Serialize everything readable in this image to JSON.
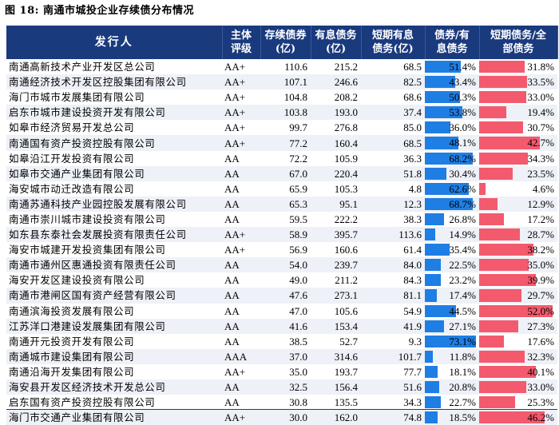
{
  "title": "图 18:  南通市城投企业存续债分布情况",
  "table": {
    "headers": {
      "issuer": "发行人",
      "rating": [
        "主体",
        "评级"
      ],
      "outstanding": [
        "存续债券",
        "(亿)"
      ],
      "interest_debt": [
        "有息债务",
        "(亿)"
      ],
      "short_term_debt": [
        "短期有息",
        "债务(亿)"
      ],
      "bond_ratio": [
        "债券/有",
        "息债务"
      ],
      "short_ratio": [
        "短期债务/全",
        "部债务"
      ]
    },
    "colors": {
      "header_bg": "#1a3a7e",
      "bar_blue": "#1f7ee3",
      "bar_red": "#f35a6d",
      "stripe": "#eef1f7"
    },
    "rows": [
      {
        "name": "南通高新技术产业开发区总公司",
        "rating": "AA+",
        "outstanding": "110.6",
        "interest_debt": "215.2",
        "short_term": "68.5",
        "bond_ratio": "51.4%",
        "bond_ratio_value": 0.514,
        "short_ratio": "31.8%",
        "short_ratio_value": 0.318
      },
      {
        "name": "南通经济技术开发区控股集团有限公司",
        "rating": "AA+",
        "outstanding": "107.1",
        "interest_debt": "246.6",
        "short_term": "82.5",
        "bond_ratio": "43.4%",
        "bond_ratio_value": 0.434,
        "short_ratio": "33.5%",
        "short_ratio_value": 0.335
      },
      {
        "name": "海门市城市发展集团有限公司",
        "rating": "AA+",
        "outstanding": "104.8",
        "interest_debt": "208.2",
        "short_term": "68.6",
        "bond_ratio": "50.3%",
        "bond_ratio_value": 0.503,
        "short_ratio": "33.0%",
        "short_ratio_value": 0.33
      },
      {
        "name": "启东市城市建设投资开发有限公司",
        "rating": "AA+",
        "outstanding": "103.8",
        "interest_debt": "193.0",
        "short_term": "37.4",
        "bond_ratio": "53.8%",
        "bond_ratio_value": 0.538,
        "short_ratio": "19.4%",
        "short_ratio_value": 0.194
      },
      {
        "name": "如皋市经济贸易开发总公司",
        "rating": "AA+",
        "outstanding": "99.7",
        "interest_debt": "276.8",
        "short_term": "85.0",
        "bond_ratio": "36.0%",
        "bond_ratio_value": 0.36,
        "short_ratio": "30.7%",
        "short_ratio_value": 0.307
      },
      {
        "name": "南通国有资产投资控股有限公司",
        "rating": "AA+",
        "outstanding": "77.2",
        "interest_debt": "160.4",
        "short_term": "68.5",
        "bond_ratio": "48.1%",
        "bond_ratio_value": 0.481,
        "short_ratio": "42.7%",
        "short_ratio_value": 0.427
      },
      {
        "name": "如皋沿江开发投资有限公司",
        "rating": "AA",
        "outstanding": "72.2",
        "interest_debt": "105.9",
        "short_term": "36.3",
        "bond_ratio": "68.2%",
        "bond_ratio_value": 0.682,
        "short_ratio": "34.3%",
        "short_ratio_value": 0.343
      },
      {
        "name": "如皋市交通产业集团有限公司",
        "rating": "AA",
        "outstanding": "67.0",
        "interest_debt": "220.4",
        "short_term": "51.8",
        "bond_ratio": "30.4%",
        "bond_ratio_value": 0.304,
        "short_ratio": "23.5%",
        "short_ratio_value": 0.235
      },
      {
        "name": "海安城市动迁改造有限公司",
        "rating": "AA",
        "outstanding": "65.9",
        "interest_debt": "105.3",
        "short_term": "4.8",
        "bond_ratio": "62.6%",
        "bond_ratio_value": 0.626,
        "short_ratio": "4.6%",
        "short_ratio_value": 0.046
      },
      {
        "name": "南通苏通科技产业园控股发展有限公司",
        "rating": "AA",
        "outstanding": "65.3",
        "interest_debt": "95.1",
        "short_term": "12.3",
        "bond_ratio": "68.7%",
        "bond_ratio_value": 0.687,
        "short_ratio": "12.9%",
        "short_ratio_value": 0.129
      },
      {
        "name": "南通市崇川城市建设投资有限公司",
        "rating": "AA",
        "outstanding": "59.5",
        "interest_debt": "222.2",
        "short_term": "38.3",
        "bond_ratio": "26.8%",
        "bond_ratio_value": 0.268,
        "short_ratio": "17.2%",
        "short_ratio_value": 0.172
      },
      {
        "name": "如东县东泰社会发展投资有限责任公司",
        "rating": "AA+",
        "outstanding": "58.9",
        "interest_debt": "395.7",
        "short_term": "113.6",
        "bond_ratio": "14.9%",
        "bond_ratio_value": 0.149,
        "short_ratio": "28.7%",
        "short_ratio_value": 0.287
      },
      {
        "name": "海安市城建开发投资集团有限公司",
        "rating": "AA+",
        "outstanding": "56.9",
        "interest_debt": "160.6",
        "short_term": "61.4",
        "bond_ratio": "35.4%",
        "bond_ratio_value": 0.354,
        "short_ratio": "38.2%",
        "short_ratio_value": 0.382
      },
      {
        "name": "南通市通州区惠通投资有限责任公司",
        "rating": "AA",
        "outstanding": "54.0",
        "interest_debt": "239.7",
        "short_term": "84.0",
        "bond_ratio": "22.5%",
        "bond_ratio_value": 0.225,
        "short_ratio": "35.0%",
        "short_ratio_value": 0.35
      },
      {
        "name": "海安开发区建设投资有限公司",
        "rating": "AA",
        "outstanding": "49.0",
        "interest_debt": "211.2",
        "short_term": "84.3",
        "bond_ratio": "23.2%",
        "bond_ratio_value": 0.232,
        "short_ratio": "39.9%",
        "short_ratio_value": 0.399
      },
      {
        "name": "南通市港闸区国有资产经营有限公司",
        "rating": "AA",
        "outstanding": "47.6",
        "interest_debt": "273.1",
        "short_term": "81.1",
        "bond_ratio": "17.4%",
        "bond_ratio_value": 0.174,
        "short_ratio": "29.7%",
        "short_ratio_value": 0.297
      },
      {
        "name": "南通滨海投资发展有限公司",
        "rating": "AA",
        "outstanding": "47.0",
        "interest_debt": "105.6",
        "short_term": "54.9",
        "bond_ratio": "44.5%",
        "bond_ratio_value": 0.445,
        "short_ratio": "52.0%",
        "short_ratio_value": 0.52
      },
      {
        "name": "江苏洋口港建设发展集团有限公司",
        "rating": "AA",
        "outstanding": "41.6",
        "interest_debt": "153.4",
        "short_term": "41.9",
        "bond_ratio": "27.1%",
        "bond_ratio_value": 0.271,
        "short_ratio": "27.3%",
        "short_ratio_value": 0.273
      },
      {
        "name": "南通开元投资开发有限公司",
        "rating": "AA",
        "outstanding": "38.5",
        "interest_debt": "52.7",
        "short_term": "9.3",
        "bond_ratio": "73.1%",
        "bond_ratio_value": 0.731,
        "short_ratio": "17.6%",
        "short_ratio_value": 0.176
      },
      {
        "name": "南通城市建设集团有限公司",
        "rating": "AAA",
        "outstanding": "37.0",
        "interest_debt": "314.6",
        "short_term": "101.7",
        "bond_ratio": "11.8%",
        "bond_ratio_value": 0.118,
        "short_ratio": "32.3%",
        "short_ratio_value": 0.323
      },
      {
        "name": "南通沿海开发集团有限公司",
        "rating": "AA+",
        "outstanding": "35.0",
        "interest_debt": "193.7",
        "short_term": "77.7",
        "bond_ratio": "18.1%",
        "bond_ratio_value": 0.181,
        "short_ratio": "40.1%",
        "short_ratio_value": 0.401
      },
      {
        "name": "海安县开发区经济技术开发总公司",
        "rating": "AA",
        "outstanding": "32.5",
        "interest_debt": "156.4",
        "short_term": "51.6",
        "bond_ratio": "20.8%",
        "bond_ratio_value": 0.208,
        "short_ratio": "33.0%",
        "short_ratio_value": 0.33
      },
      {
        "name": "启东国有资产投资控股有限公司",
        "rating": "AA",
        "outstanding": "30.8",
        "interest_debt": "135.5",
        "short_term": "34.3",
        "bond_ratio": "22.7%",
        "bond_ratio_value": 0.227,
        "short_ratio": "25.3%",
        "short_ratio_value": 0.253
      },
      {
        "name": "海门市交通产业集团有限公司",
        "rating": "AA+",
        "outstanding": "30.0",
        "interest_debt": "162.0",
        "short_term": "74.8",
        "bond_ratio": "18.5%",
        "bond_ratio_value": 0.185,
        "short_ratio": "46.2%",
        "short_ratio_value": 0.462
      }
    ]
  }
}
